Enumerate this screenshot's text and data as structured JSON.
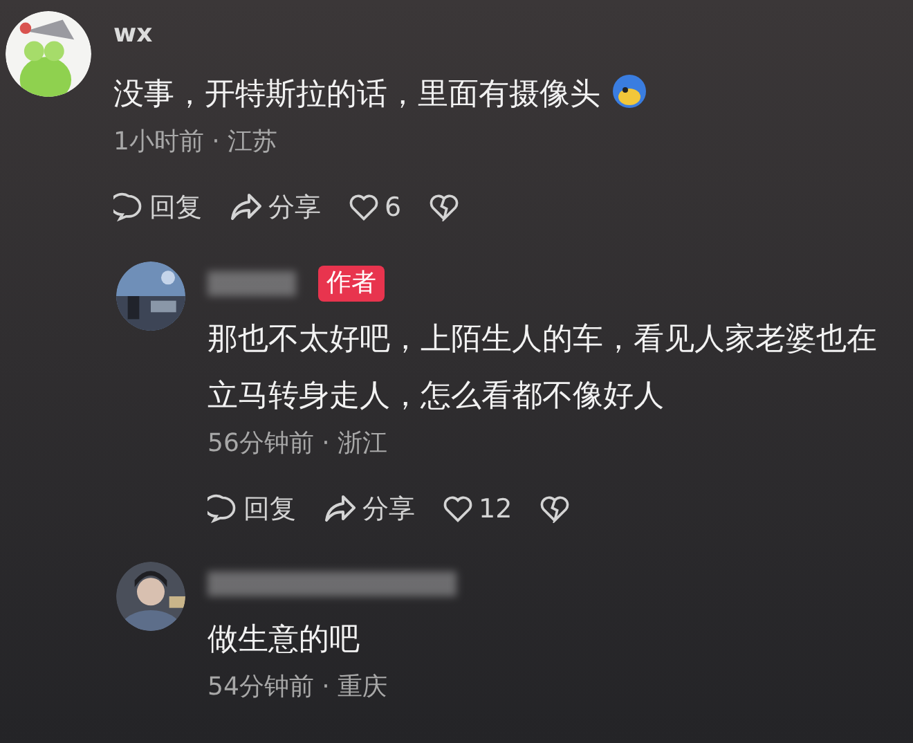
{
  "comments": [
    {
      "name": "wx",
      "text": "没事，开特斯拉的话，里面有摄像头",
      "emoji": true,
      "meta": "1小时前 · 江苏",
      "actions": {
        "reply": "回复",
        "share": "分享",
        "likes": "6"
      },
      "children": [
        {
          "badge": "作者",
          "text": "那也不太好吧，上陌生人的车，看见人家老婆也在立马转身走人，怎么看都不像好人",
          "meta": "56分钟前 · 浙江",
          "actions": {
            "reply": "回复",
            "share": "分享",
            "likes": "12"
          }
        },
        {
          "text": "做生意的吧",
          "meta": "54分钟前 · 重庆"
        }
      ]
    }
  ]
}
